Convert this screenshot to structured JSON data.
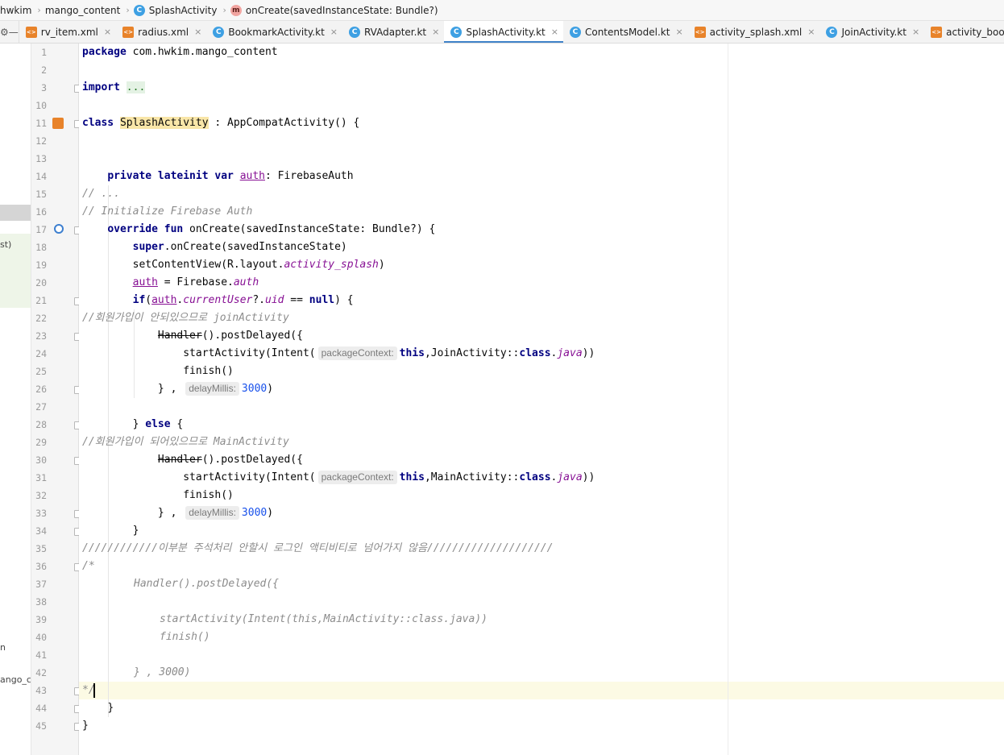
{
  "breadcrumb": {
    "items": [
      "hwkim",
      "mango_content",
      "SplashActivity",
      "onCreate(savedInstanceState: Bundle?)"
    ]
  },
  "tabs": [
    {
      "label": "rv_item.xml",
      "type": "xml",
      "active": false
    },
    {
      "label": "radius.xml",
      "type": "xml",
      "active": false
    },
    {
      "label": "BookmarkActivity.kt",
      "type": "kt",
      "active": false
    },
    {
      "label": "RVAdapter.kt",
      "type": "kt",
      "active": false
    },
    {
      "label": "SplashActivity.kt",
      "type": "kt",
      "active": true
    },
    {
      "label": "ContentsModel.kt",
      "type": "kt",
      "active": false
    },
    {
      "label": "activity_splash.xml",
      "type": "xml",
      "active": false
    },
    {
      "label": "JoinActivity.kt",
      "type": "kt",
      "active": false
    },
    {
      "label": "activity_bookmark.xml",
      "type": "xml",
      "active": false
    }
  ],
  "tab_close_glyph": "×",
  "left_panel": {
    "fragments": [
      "st)",
      "n",
      "ango_co"
    ]
  },
  "line_numbers": [
    "1",
    "2",
    "3",
    "10",
    "11",
    "12",
    "13",
    "14",
    "15",
    "16",
    "17",
    "18",
    "19",
    "20",
    "21",
    "22",
    "23",
    "24",
    "25",
    "26",
    "27",
    "28",
    "29",
    "30",
    "31",
    "32",
    "33",
    "34",
    "35",
    "36",
    "37",
    "38",
    "39",
    "40",
    "41",
    "42",
    "43",
    "44",
    "45"
  ],
  "code": {
    "l1_kw": "package",
    "l1_rest": " com.hwkim.mango_content",
    "l3_kw": "import",
    "l3_dots": "...",
    "l11_kw": "class",
    "l11_name": "SplashActivity",
    "l11_rest": " : AppCompatActivity() {",
    "l14_kw": "private lateinit var",
    "l14_auth": "auth",
    "l14_rest": ": FirebaseAuth",
    "l15_cmt": "// ...",
    "l16_cmt": "// Initialize Firebase Auth",
    "l17_kw": "override fun",
    "l17_rest": " onCreate(savedInstanceState: Bundle?) {",
    "l18_kw": "super",
    "l18_rest": ".onCreate(savedInstanceState)",
    "l19_a": "setContentView(R.layout.",
    "l19_b": "activity_splash",
    "l19_c": ")",
    "l20_auth": "auth",
    "l20_a": " = Firebase.",
    "l20_b": "auth",
    "l21_kw": "if",
    "l21_a": "(",
    "l21_auth": "auth",
    "l21_b": ".",
    "l21_user": "currentUser",
    "l21_c": "?.",
    "l21_uid": "uid",
    "l21_d": " == ",
    "l21_null": "null",
    "l21_e": ") {",
    "l22_cmt": "//회원가입이 안되있으므로 joinActivity",
    "l23_handler": "Handler",
    "l23_rest": "().postDelayed({",
    "l24_a": "startActivity(Intent(",
    "hint_context": "packageContext:",
    "l24_this": "this",
    "l24_b": ",JoinActivity::",
    "kw_class": "class",
    "l24_c": ".",
    "java": "java",
    "l24_d": "))",
    "l25": "finish()",
    "l26_a": "} ,",
    "hint_delay": "delayMillis:",
    "l26_num": "3000",
    "l26_b": ")",
    "l28_a": "} ",
    "l28_kw": "else",
    "l28_b": " {",
    "l29_cmt": "//회원가입이 되어있으므로 MainActivity",
    "l31_b": ",MainActivity::",
    "l34": "}",
    "l35_cmt": "////////////이부분 주석처리 안할시 로그인 액티비티로 넘어가지 않음////////////////////",
    "l36_cmt": "/*",
    "l37_cmt": "Handler().postDelayed({",
    "l39_cmt": "startActivity(Intent(this,MainActivity::class.java))",
    "l40_cmt": "finish()",
    "l42_cmt": "} , 3000)",
    "l43_cmt": "*/",
    "l44": "}",
    "l45": "}"
  }
}
